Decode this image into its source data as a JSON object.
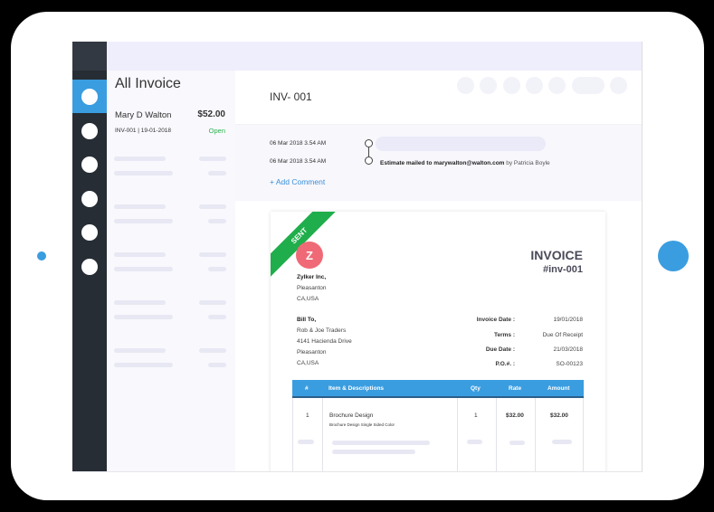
{
  "sidebar": {
    "items": [
      {
        "icon": "nav-icon-1",
        "active": true
      },
      {
        "icon": "nav-icon-2",
        "active": false
      },
      {
        "icon": "nav-icon-3",
        "active": false
      },
      {
        "icon": "nav-icon-4",
        "active": false
      },
      {
        "icon": "nav-icon-5",
        "active": false
      },
      {
        "icon": "nav-icon-6",
        "active": false
      }
    ]
  },
  "list": {
    "title": "All Invoice",
    "items": [
      {
        "customer": "Mary D Walton",
        "amount": "$52.00",
        "meta": "INV-001 | 19-01-2018",
        "status": "Open"
      }
    ]
  },
  "main": {
    "invoice_id": "INV- 001",
    "activity": [
      {
        "time": "06 Mar 2018 3.54 AM",
        "text": ""
      },
      {
        "time": "06 Mar 2018 3.54 AM",
        "text": "Estimate mailed to marywalton@walton.com",
        "by": "by Patricia Boyle"
      }
    ],
    "add_comment": "+ Add Comment"
  },
  "document": {
    "ribbon": "SENT",
    "logo_letter": "Z",
    "company": {
      "name": "Zylker Inc,",
      "lines": [
        "Pleasanton",
        "CA,USA"
      ]
    },
    "title": "INVOICE",
    "number": "#inv-001",
    "bill_to": {
      "label": "Bill To,",
      "lines": [
        "Rob & Joe Traders",
        "4141 Hacienda Drive",
        "Pleasanton",
        "CA,USA"
      ]
    },
    "meta": [
      {
        "label": "Invoice Date :",
        "value": "19/01/2018"
      },
      {
        "label": "Terms :",
        "value": "Due Of Receipt"
      },
      {
        "label": "Due Date :",
        "value": "21/03/2018"
      },
      {
        "label": "P.O.#. :",
        "value": "SO-00123"
      }
    ],
    "table": {
      "headers": [
        "#",
        "Item & Descriptions",
        "Qty",
        "Rate",
        "Amount"
      ],
      "rows": [
        {
          "num": "1",
          "item": "Brochure Design",
          "desc": "Brochure Design Single Sided Color",
          "qty": "1",
          "rate": "$32.00",
          "amount": "$32.00"
        }
      ]
    }
  },
  "colors": {
    "accent": "#3a9de0",
    "sidebar": "#262d35",
    "sent": "#1fae4b",
    "logo": "#ef6a76",
    "open": "#2cb24c"
  }
}
